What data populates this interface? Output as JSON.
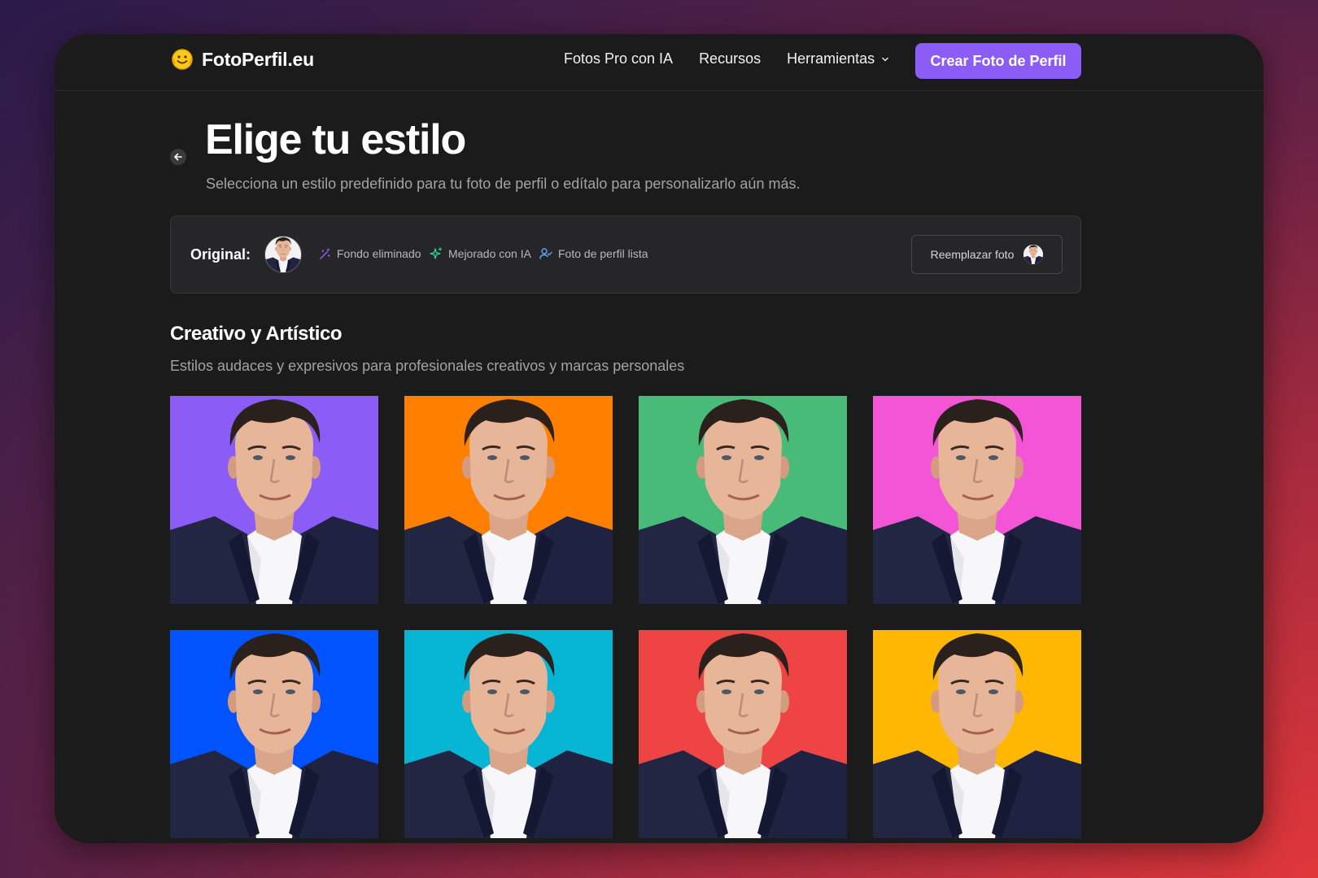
{
  "brand": {
    "name": "FotoPerfil.eu"
  },
  "nav": {
    "links": [
      "Fotos Pro con IA",
      "Recursos",
      "Herramientas"
    ],
    "cta": "Crear Foto de Perfil"
  },
  "header": {
    "title": "Elige tu estilo",
    "subtitle": "Selecciona un estilo predefinido para tu foto de perfil o edítalo para personalizarlo aún más."
  },
  "original": {
    "label": "Original:",
    "features": [
      "Fondo eliminado",
      "Mejorado con IA",
      "Foto de perfil lista"
    ],
    "replace_label": "Reemplazar foto"
  },
  "section": {
    "title": "Creativo y Artístico",
    "subtitle": "Estilos audaces y expresivos para profesionales creativos y marcas personales"
  },
  "styles": [
    {
      "color": "#8b5cf6"
    },
    {
      "color": "#ff7f00"
    },
    {
      "color": "#48bb78"
    },
    {
      "color": "#f454d6"
    },
    {
      "color": "#0053ff"
    },
    {
      "color": "#06b4d4"
    },
    {
      "color": "#ef4444"
    },
    {
      "color": "#ffb703"
    }
  ],
  "colors": {
    "accent": "#8b5cf6",
    "window_bg": "#1b1b1c",
    "card_bg": "#262628"
  }
}
